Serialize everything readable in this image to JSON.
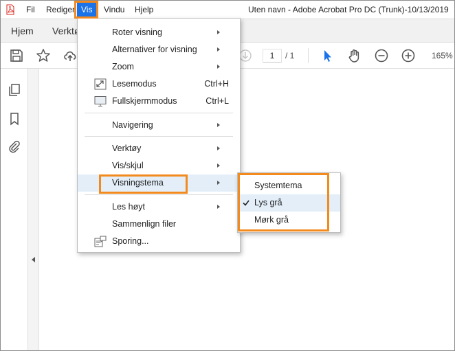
{
  "menubar": {
    "items": [
      {
        "label": "Fil",
        "active": false
      },
      {
        "label": "Rediger",
        "active": false
      },
      {
        "label": "Vis",
        "active": true
      },
      {
        "label": "Vindu",
        "active": false
      },
      {
        "label": "Hjelp",
        "active": false
      }
    ],
    "window_title": "Uten navn - Adobe Acrobat Pro DC (Trunk)-10/13/2019"
  },
  "tabs": [
    {
      "label": "Hjem"
    },
    {
      "label": "Verktø"
    }
  ],
  "toolbar": {
    "page_current": "1",
    "page_total": "/ 1",
    "zoom": "165%"
  },
  "view_menu": {
    "items": [
      {
        "label": "Roter visning",
        "submenu": true
      },
      {
        "label": "Alternativer for visning",
        "submenu": true
      },
      {
        "label": "Zoom",
        "submenu": true
      },
      {
        "label": "Lesemodus",
        "shortcut": "Ctrl+H",
        "icon": "reading-mode-icon"
      },
      {
        "label": "Fullskjermmodus",
        "shortcut": "Ctrl+L",
        "icon": "full-screen-icon"
      },
      {
        "label": "Navigering",
        "submenu": true
      },
      {
        "label": "Verktøy",
        "submenu": true
      },
      {
        "label": "Vis/skjul",
        "submenu": true
      },
      {
        "label": "Visningstema",
        "submenu": true,
        "highlighted": true
      },
      {
        "label": "Les høyt",
        "submenu": true
      },
      {
        "label": "Sammenlign filer"
      },
      {
        "label": "Sporing...",
        "icon": "tracking-icon"
      }
    ]
  },
  "theme_submenu": {
    "items": [
      {
        "label": "Systemtema",
        "checked": false
      },
      {
        "label": "Lys grå",
        "checked": true
      },
      {
        "label": "Mørk grå",
        "checked": false
      }
    ]
  },
  "colors": {
    "accent_orange": "#f28a1e",
    "menu_active_blue": "#1a73e8",
    "highlight_row": "#e3eef9",
    "cursor_blue": "#1a73e8"
  }
}
